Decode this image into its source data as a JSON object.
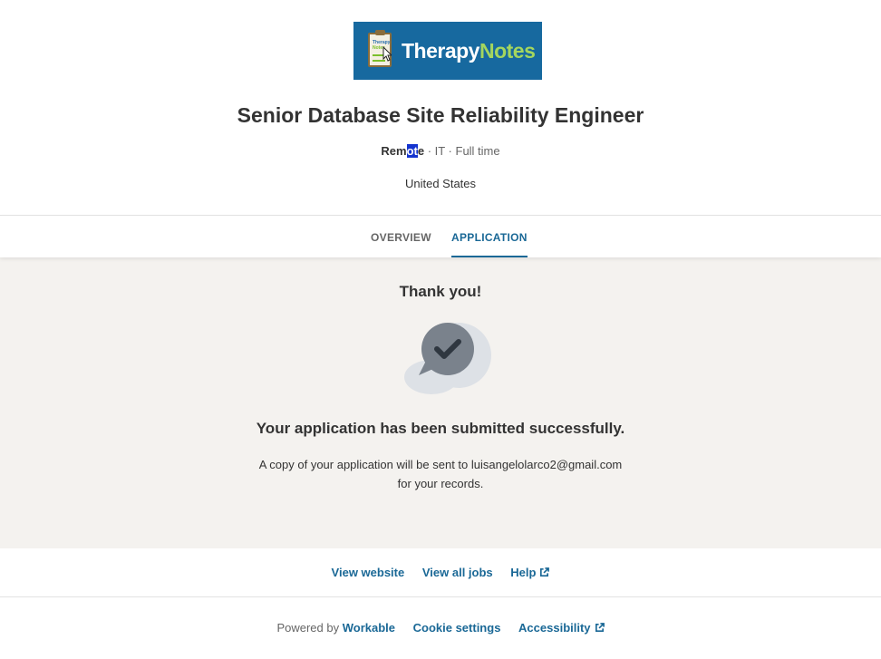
{
  "brand": {
    "wordmark_part1": "Therapy",
    "wordmark_part2": "Notes",
    "clipboard_line1": "Therapy",
    "clipboard_line2": "Notes",
    "colors": {
      "logo_bg": "#17699f",
      "accent_green": "#a4d65e",
      "link": "#1a6896",
      "page_bg": "#f4f2ef"
    }
  },
  "job": {
    "title": "Senior Database Site Reliability Engineer",
    "remote_a": "Rem",
    "remote_highlight": "ot",
    "remote_b": "e",
    "meta_rest": " · IT · Full time",
    "location": "United States"
  },
  "tabs": {
    "overview": "OVERVIEW",
    "application": "APPLICATION",
    "active": "APPLICATION"
  },
  "confirmation": {
    "heading": "Thank you!",
    "icon": "chat-bubble-check-icon",
    "message": "Your application has been submitted successfully.",
    "copy_line1": "A copy of your application will be sent to luisangelolarco2@gmail.com",
    "copy_line2": "for your records."
  },
  "links": {
    "view_website": "View website",
    "view_all_jobs": "View all jobs",
    "help": "Help",
    "external_icon": "external-link-icon"
  },
  "footer": {
    "powered_by": "Powered by",
    "workable": "Workable",
    "cookie_settings": "Cookie settings",
    "accessibility": "Accessibility"
  }
}
